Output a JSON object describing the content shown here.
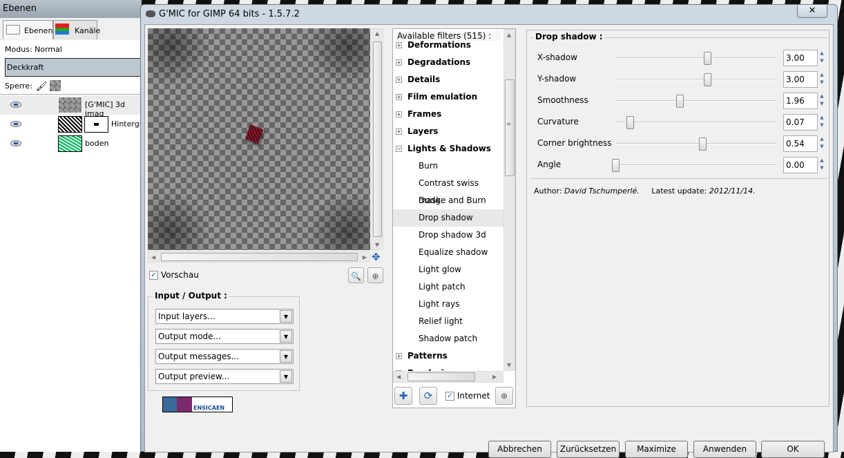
{
  "gimp_panel": {
    "title": "Ebenen",
    "tabs": [
      {
        "label": "Ebenen"
      },
      {
        "label": "Kanäle"
      }
    ],
    "mode_label": "Modus: Normal",
    "opacity_label": "Deckkraft",
    "lock_label": "Sperre:",
    "layers": [
      {
        "name": "[G'MIC] 3d imag",
        "visible": true
      },
      {
        "name": "Hintergr",
        "visible": true
      },
      {
        "name": "boden",
        "visible": true
      }
    ]
  },
  "dialog": {
    "title": "G'MIC for GIMP 64 bits - 1.5.7.2",
    "close_icon": "close-icon",
    "preview": {
      "checkbox_label": "Vorschau",
      "checked": true
    },
    "io_group": {
      "title": "Input / Output :",
      "combos": [
        "Input layers...",
        "Output mode...",
        "Output messages...",
        "Output preview..."
      ]
    },
    "logo_text": "ENSICAEN",
    "filters": {
      "header": "Available filters (515) :",
      "items": [
        {
          "label": "Deformations",
          "type": "category",
          "expanded": false
        },
        {
          "label": "Degradations",
          "type": "category",
          "expanded": false
        },
        {
          "label": "Details",
          "type": "category",
          "expanded": false
        },
        {
          "label": "Film emulation",
          "type": "category",
          "expanded": false
        },
        {
          "label": "Frames",
          "type": "category",
          "expanded": false
        },
        {
          "label": "Layers",
          "type": "category",
          "expanded": false
        },
        {
          "label": "Lights & Shadows",
          "type": "category",
          "expanded": true
        },
        {
          "label": "Burn",
          "type": "filter"
        },
        {
          "label": "Contrast swiss mask",
          "type": "filter"
        },
        {
          "label": "Dodge and Burn",
          "type": "filter"
        },
        {
          "label": "Drop shadow",
          "type": "filter",
          "selected": true
        },
        {
          "label": "Drop shadow 3d",
          "type": "filter"
        },
        {
          "label": "Equalize shadow",
          "type": "filter"
        },
        {
          "label": "Light glow",
          "type": "filter"
        },
        {
          "label": "Light patch",
          "type": "filter"
        },
        {
          "label": "Light rays",
          "type": "filter"
        },
        {
          "label": "Relief light",
          "type": "filter"
        },
        {
          "label": "Shadow patch",
          "type": "filter"
        },
        {
          "label": "Patterns",
          "type": "category",
          "expanded": false
        },
        {
          "label": "Rendering",
          "type": "category",
          "expanded": false
        }
      ],
      "internet_label": "Internet",
      "internet_checked": true
    },
    "params": {
      "title": "Drop shadow :",
      "rows": [
        {
          "label": "X-shadow",
          "value": "3.00",
          "slider": 0.57
        },
        {
          "label": "Y-shadow",
          "value": "3.00",
          "slider": 0.57
        },
        {
          "label": "Smoothness",
          "value": "1.96",
          "slider": 0.4
        },
        {
          "label": "Curvature",
          "value": "0.07",
          "slider": 0.09
        },
        {
          "label": "Corner brightness",
          "value": "0.54",
          "slider": 0.54
        },
        {
          "label": "Angle",
          "value": "0.00",
          "slider": 0.0
        }
      ],
      "author_label": "Author:",
      "author": "David Tschumperlé.",
      "update_label": "Latest update:",
      "update": "2012/11/14."
    },
    "buttons": [
      "Abbrechen",
      "Zurücksetzen",
      "Maximize",
      "Anwenden",
      "OK"
    ]
  }
}
